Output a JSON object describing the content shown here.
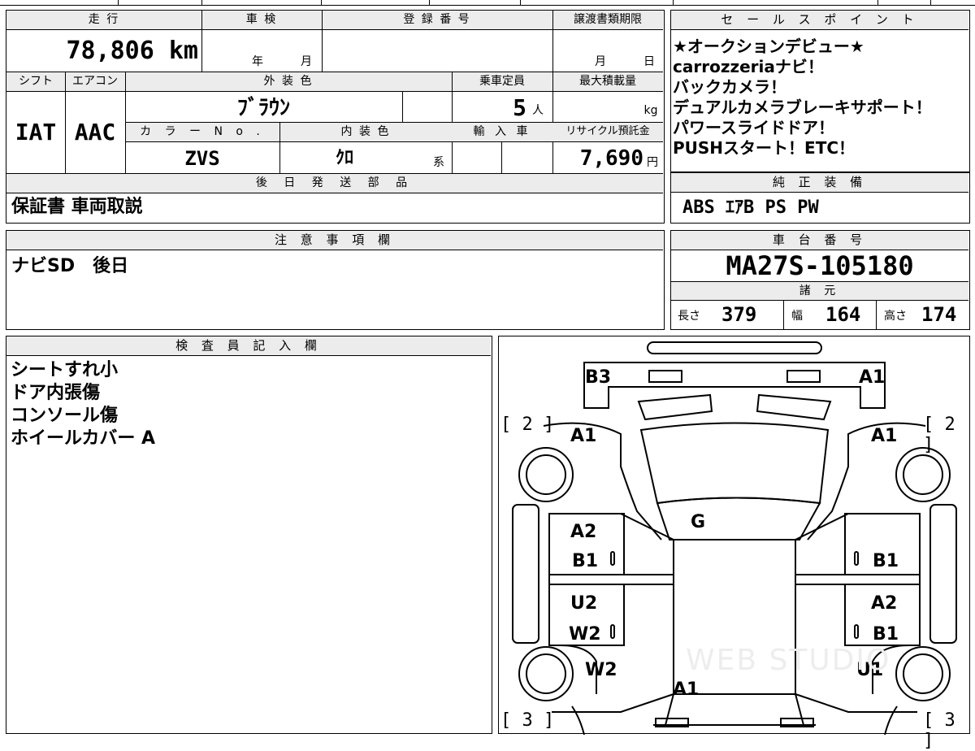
{
  "top_strip": "",
  "mileage": {
    "header": "走 行",
    "value": "78,806 km"
  },
  "inspection": {
    "header": "車 検",
    "year_unit": "年",
    "month_unit": "月"
  },
  "registration": {
    "header": "登 録 番 号",
    "value": ""
  },
  "transfer_deadline": {
    "header": "譲渡書類期限",
    "month_unit": "月",
    "day_unit": "日"
  },
  "sales_points": {
    "header": "セ ー ル ス ポ イ ン ト",
    "lines": [
      "★オークションデビュー★",
      "carrozzeriaナビ！",
      "バックカメラ！",
      "デュアルカメラブレーキサポート！",
      "パワースライドドア！",
      "PUSHスタート！ETC！"
    ]
  },
  "shift": {
    "header": "シフト",
    "value": "IAT"
  },
  "aircon": {
    "header": "エアコン",
    "value": "AAC"
  },
  "exterior_color": {
    "header": "外 装 色",
    "value": "ﾌﾞﾗｳﾝ"
  },
  "capacity": {
    "header": "乗車定員",
    "value": "5",
    "unit": "人"
  },
  "max_load": {
    "header": "最大積載量",
    "unit": "kg"
  },
  "color_no": {
    "header": "カ ラ ー N o .",
    "value": "ZVS"
  },
  "interior_color": {
    "header": "内 装 色",
    "value": "ｸﾛ",
    "suffix": "系"
  },
  "import_car": {
    "header": "輸 入 車"
  },
  "recycle_fee": {
    "header": "リサイクル預託金",
    "value": "7,690",
    "unit": "円"
  },
  "later_parts": {
    "header": "後 日 発 送 部 品",
    "value": "保証書 車両取説"
  },
  "genuine_equipment": {
    "header": "純 正 装 備",
    "value": "ABS ｴｱB PS PW"
  },
  "caution": {
    "header": "注 意 事 項 欄",
    "value": "ナビSD　後日"
  },
  "chassis": {
    "header": "車 台 番 号",
    "value": "MA27S-105180"
  },
  "specs": {
    "header": "諸 元",
    "length_label": "長さ",
    "length": "379",
    "width_label": "幅",
    "width": "164",
    "height_label": "高さ",
    "height": "174"
  },
  "inspector": {
    "header": "検 査 員 記 入 欄",
    "lines": [
      "シートすれ小",
      "ドア内張傷",
      "コンソール傷",
      "ホイールカバー A"
    ]
  },
  "diagram": {
    "labels": {
      "rear_left": "B3",
      "rear_right": "A1",
      "bracket_tl": "[ 2 ]",
      "bracket_tr": "[ 2 ]",
      "bracket_bl": "[ 3 ]",
      "bracket_br": "[ 3 ]",
      "fender_rl": "A1",
      "fender_rr": "A1",
      "glass": "G",
      "door_rl_1": "A2",
      "door_rl_2": "B1",
      "door_rr": "B1",
      "door_fl_1": "U2",
      "door_fl_2": "W2",
      "door_fr_1": "A2",
      "door_fr_2": "B1",
      "fender_fl": "W2",
      "fender_fr": "U1",
      "hood": "A1",
      "zero_1": "0",
      "zero_2": "0",
      "zero_3": "0",
      "zero_4": "0"
    },
    "watermark": "WEB STUDIO"
  }
}
